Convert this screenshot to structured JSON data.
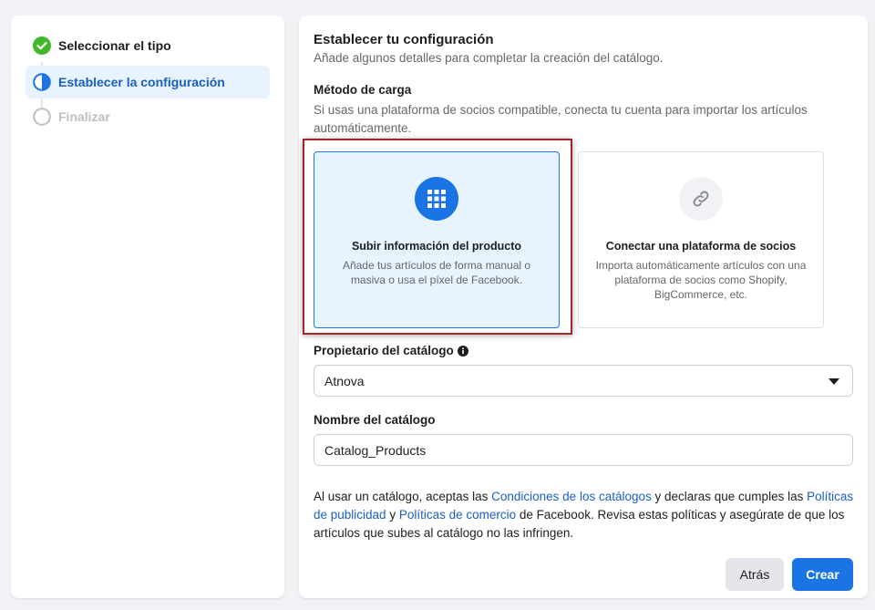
{
  "sidebar": {
    "steps": [
      {
        "label": "Seleccionar el tipo",
        "state": "done"
      },
      {
        "label": "Establecer la configuración",
        "state": "current"
      },
      {
        "label": "Finalizar",
        "state": "pending"
      }
    ]
  },
  "header": {
    "title": "Establecer tu configuración",
    "subtitle": "Añade algunos detalles para completar la creación del catálogo."
  },
  "upload_method": {
    "title": "Método de carga",
    "description": "Si usas una plataforma de socios compatible, conecta tu cuenta para importar los artículos automáticamente.",
    "options": [
      {
        "title": "Subir información del producto",
        "description": "Añade tus artículos de forma manual o masiva o usa el píxel de Facebook.",
        "icon": "grid-icon",
        "selected": true
      },
      {
        "title": "Conectar una plataforma de socios",
        "description": "Importa automáticamente artículos con una plataforma de socios como Shopify, BigCommerce, etc.",
        "icon": "link-icon",
        "selected": false
      }
    ]
  },
  "owner": {
    "label": "Propietario del catálogo",
    "value": "Atnova"
  },
  "catalog_name": {
    "label": "Nombre del catálogo",
    "value": "Catalog_Products"
  },
  "terms": {
    "part1": "Al usar un catálogo, aceptas las ",
    "link1": "Condiciones de los catálogos",
    "part2": " y declaras que cumples las ",
    "link2": "Políticas de publicidad",
    "part3": " y ",
    "link3": "Políticas de comercio",
    "part4": " de Facebook. Revisa estas políticas y asegúrate de que los artículos que subes al catálogo no las infringen."
  },
  "buttons": {
    "back": "Atrás",
    "create": "Crear"
  },
  "colors": {
    "accent": "#1b74e4",
    "link": "#1b5fc4",
    "success": "#42b72a",
    "highlight_border": "#a5262a"
  }
}
